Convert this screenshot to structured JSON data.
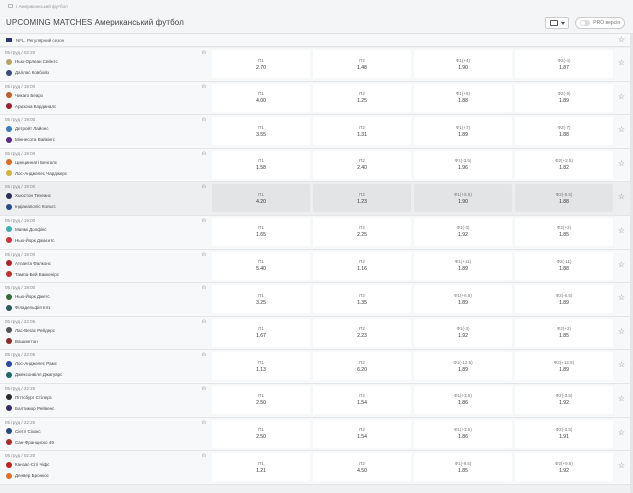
{
  "breadcrumb": {
    "current": "Американський футбол"
  },
  "header": {
    "title": "UPCOMING MATCHES Американський футбол",
    "pro_label": "PRO версія"
  },
  "league": {
    "name": "NFL. Регулярний сезон"
  },
  "matches": [
    {
      "date": "05 груд / 02:20",
      "team1": "Нью-Орлеан Сейнтс",
      "team2": "Даллас Ковбойз",
      "logo1": "#b8a36a",
      "logo2": "#3a4a7a",
      "odds": [
        {
          "l": "П1",
          "v": "2.70"
        },
        {
          "l": "П2",
          "v": "1.48"
        },
        {
          "l": "Ф1(+4)",
          "v": "1.90"
        },
        {
          "l": "Ф2(-4)",
          "v": "1.87"
        }
      ]
    },
    {
      "date": "05 груд / 19:00",
      "team1": "Чикаго Беарз",
      "team2": "Аризона Кардиналс",
      "logo1": "#c85a2a",
      "logo2": "#9a2030",
      "odds": [
        {
          "l": "П1",
          "v": "4.00"
        },
        {
          "l": "П2",
          "v": "1.25"
        },
        {
          "l": "Ф1(+8)",
          "v": "1.88"
        },
        {
          "l": "Ф2(-8)",
          "v": "1.89"
        }
      ]
    },
    {
      "date": "05 груд / 19:00",
      "team1": "Детройт Лайонс",
      "team2": "Міннесота Вайкінгс",
      "logo1": "#3a7ac0",
      "logo2": "#5a2a8a",
      "odds": [
        {
          "l": "П1",
          "v": "3.55"
        },
        {
          "l": "П2",
          "v": "1.31"
        },
        {
          "l": "Ф1(+7)",
          "v": "1.89"
        },
        {
          "l": "Ф2(-7)",
          "v": "1.88"
        }
      ]
    },
    {
      "date": "05 груд / 19:00",
      "team1": "Цинциннаті Бенгалс",
      "team2": "Лос-Анджелес Чарджерс",
      "logo1": "#e06a20",
      "logo2": "#d8b040",
      "odds": [
        {
          "l": "П1",
          "v": "1.58"
        },
        {
          "l": "П2",
          "v": "2.40"
        },
        {
          "l": "Ф1(-3.5)",
          "v": "1.96"
        },
        {
          "l": "Ф2(+3.5)",
          "v": "1.82"
        }
      ]
    },
    {
      "date": "05 груд / 19:00",
      "team1": "Хьюстон Техеанс",
      "team2": "Індіанаполіс Кольтс",
      "logo1": "#2a3050",
      "logo2": "#2a4a8a",
      "highlight": true,
      "odds": [
        {
          "l": "П1",
          "v": "4.20"
        },
        {
          "l": "П2",
          "v": "1.23"
        },
        {
          "l": "Ф1(+8.5)",
          "v": "1.90"
        },
        {
          "l": "Ф2(-8.5)",
          "v": "1.88"
        }
      ]
    },
    {
      "date": "05 груд / 19:00",
      "team1": "Маямі Долфінс",
      "team2": "Нью-Йорк Джаєнтс",
      "logo1": "#3ab0b0",
      "logo2": "#d03040",
      "odds": [
        {
          "l": "П1",
          "v": "1.65"
        },
        {
          "l": "П2",
          "v": "2.25"
        },
        {
          "l": "Ф1(-3)",
          "v": "1.92"
        },
        {
          "l": "Ф2(+3)",
          "v": "1.85"
        }
      ]
    },
    {
      "date": "05 груд / 19:00",
      "team1": "Атланта Фалконс",
      "team2": "Тампа-Бей Баккенірс",
      "logo1": "#b02030",
      "logo2": "#c03030",
      "odds": [
        {
          "l": "П1",
          "v": "5.40"
        },
        {
          "l": "П2",
          "v": "1.16"
        },
        {
          "l": "Ф1(+11)",
          "v": "1.89"
        },
        {
          "l": "Ф2(-11)",
          "v": "1.88"
        }
      ]
    },
    {
      "date": "05 груд / 19:00",
      "team1": "Нью-Йорк Джетс",
      "team2": "Філадельфія Іглз",
      "logo1": "#3a6a3a",
      "logo2": "#2a5a5a",
      "odds": [
        {
          "l": "П1",
          "v": "3.25"
        },
        {
          "l": "П2",
          "v": "1.35"
        },
        {
          "l": "Ф1(+6.5)",
          "v": "1.89"
        },
        {
          "l": "Ф2(-6.5)",
          "v": "1.89"
        }
      ]
    },
    {
      "date": "05 груд / 22:05",
      "team1": "Лас-Вегас Рейдерс",
      "team2": "Вашингтон",
      "logo1": "#555555",
      "logo2": "#8a2a2a",
      "odds": [
        {
          "l": "П1",
          "v": "1.67"
        },
        {
          "l": "П2",
          "v": "2.23"
        },
        {
          "l": "Ф1(-3)",
          "v": "1.92"
        },
        {
          "l": "Ф2(+3)",
          "v": "1.85"
        }
      ]
    },
    {
      "date": "05 груд / 22:05",
      "team1": "Лос-Анджелес Рамс",
      "team2": "Джексонвілл Джагуарс",
      "logo1": "#2a4aa0",
      "logo2": "#1a6a6a",
      "odds": [
        {
          "l": "П1",
          "v": "1.13"
        },
        {
          "l": "П2",
          "v": "6.20"
        },
        {
          "l": "Ф1(-12.5)",
          "v": "1.89"
        },
        {
          "l": "Ф2(+12.5)",
          "v": "1.89"
        }
      ]
    },
    {
      "date": "05 груд / 22:25",
      "team1": "Піттсбург Стілерз",
      "team2": "Балтимор Рейвенс",
      "logo1": "#2a2a2a",
      "logo2": "#3a2a6a",
      "odds": [
        {
          "l": "П1",
          "v": "2.50"
        },
        {
          "l": "П2",
          "v": "1.54"
        },
        {
          "l": "Ф1(+3.5)",
          "v": "1.86"
        },
        {
          "l": "Ф2(-3.5)",
          "v": "1.92"
        }
      ]
    },
    {
      "date": "05 груд / 22:25",
      "team1": "Сіетл Сіхокс",
      "team2": "Сан-Франциско 49",
      "logo1": "#2a4a7a",
      "logo2": "#b02a2a",
      "odds": [
        {
          "l": "П1",
          "v": "2.50"
        },
        {
          "l": "П2",
          "v": "1.54"
        },
        {
          "l": "Ф1(+3.5)",
          "v": "1.86"
        },
        {
          "l": "Ф2(-3.5)",
          "v": "1.91"
        }
      ]
    },
    {
      "date": "06 груд / 02:20",
      "team1": "Канзас-Сіті Чіфс",
      "team2": "Денвер Бронкос",
      "logo1": "#c02020",
      "logo2": "#e07020",
      "odds": [
        {
          "l": "П1",
          "v": "1.21"
        },
        {
          "l": "П2",
          "v": "4.50"
        },
        {
          "l": "Ф1(-9.5)",
          "v": "1.85"
        },
        {
          "l": "Ф2(+9.5)",
          "v": "1.92"
        }
      ]
    }
  ]
}
